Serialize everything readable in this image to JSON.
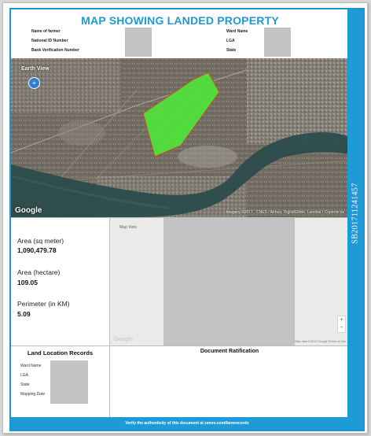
{
  "document": {
    "title": "MAP SHOWING LANDED PROPERTY",
    "serial_number": "SB201711241457",
    "accent_color": "#1e9ad6"
  },
  "header": {
    "left_fields": [
      "Name of farmer",
      "National ID Number",
      "Bank Verification Number"
    ],
    "right_fields": [
      "Ward Name",
      "LGA",
      "State"
    ]
  },
  "map": {
    "view_label": "Earth View",
    "compass_icon": "compass-icon",
    "google_label": "Google",
    "imagery_credit": "Imagery ©2017 , CNES / Airbus, DigitalGlobe, Landsat / Copernicus",
    "parcel_color": "#4fe33a"
  },
  "stats": {
    "area_sqm_label": "Area (sq meter)",
    "area_sqm_value": "1,090,479.78",
    "area_ha_label": "Area (hectare)",
    "area_ha_value": "109.05",
    "perimeter_label": "Perimeter (in KM)",
    "perimeter_value": "5.09"
  },
  "mapview": {
    "label": "Map View",
    "google_label": "Google",
    "terms": "Map data ©2017 Google   Terms of Use",
    "zoom_in": "+",
    "zoom_out": "−"
  },
  "records": {
    "title": "Land Location Records",
    "fields": [
      "Ward Name",
      "LGA",
      "State",
      "Mapping Date"
    ]
  },
  "ratification": {
    "title": "Document Ratification"
  },
  "footer": {
    "text": "Verify the authenticity of this document at zenvo.com/farmrecords"
  }
}
